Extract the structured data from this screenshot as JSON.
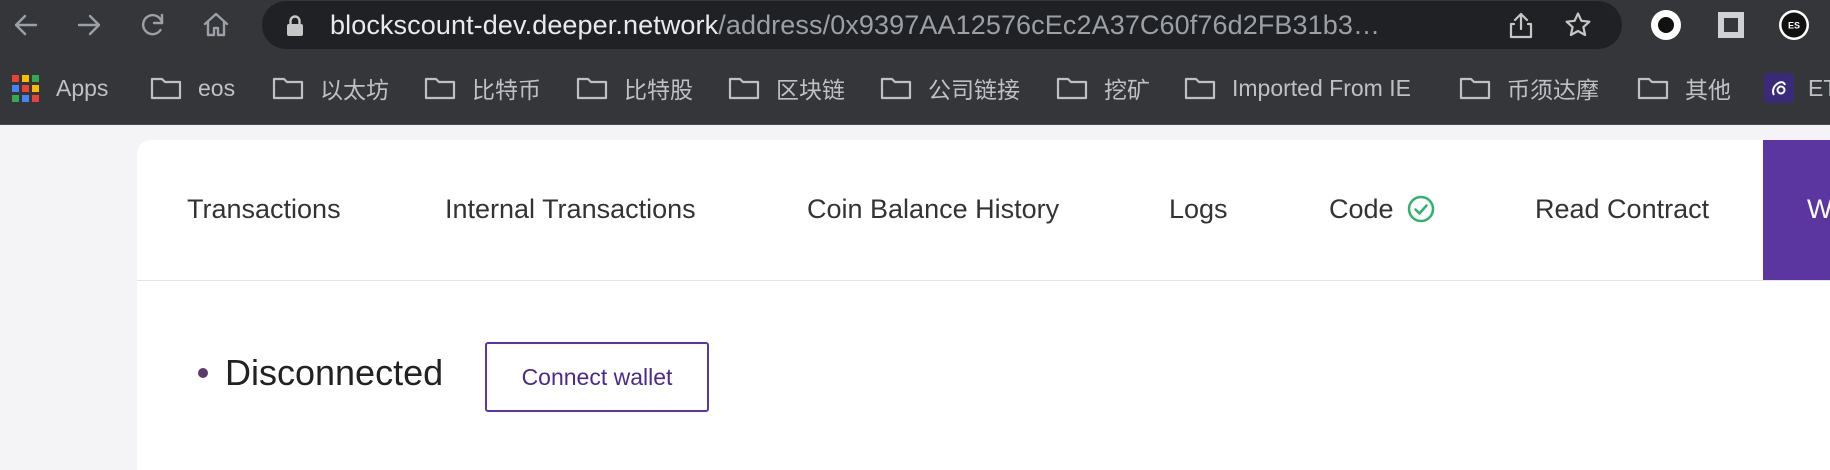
{
  "browser": {
    "url_host": "blockscount-dev.deeper.network",
    "url_path": "/address/0x9397AA12576cEc2A37C60f76d2FB31b3…"
  },
  "bookmarks": [
    {
      "label": "Apps"
    },
    {
      "label": "eos"
    },
    {
      "label": "以太坊"
    },
    {
      "label": "比特币"
    },
    {
      "label": "比特股"
    },
    {
      "label": "区块链"
    },
    {
      "label": "公司链接"
    },
    {
      "label": "挖矿"
    },
    {
      "label": "Imported From IE"
    },
    {
      "label": "币须达摩"
    },
    {
      "label": "其他"
    },
    {
      "label": "ET"
    }
  ],
  "extensions": {
    "es_label": "ES"
  },
  "tabs": [
    {
      "label": "Transactions"
    },
    {
      "label": "Internal Transactions"
    },
    {
      "label": "Coin Balance History"
    },
    {
      "label": "Logs"
    },
    {
      "label": "Code"
    },
    {
      "label": "Read Contract"
    },
    {
      "label": "W"
    }
  ],
  "wallet": {
    "status": "Disconnected",
    "connect_label": "Connect wallet"
  },
  "colors": {
    "accent": "#5b36a0",
    "verified": "#2fb36b",
    "chrome": "#35363a"
  }
}
